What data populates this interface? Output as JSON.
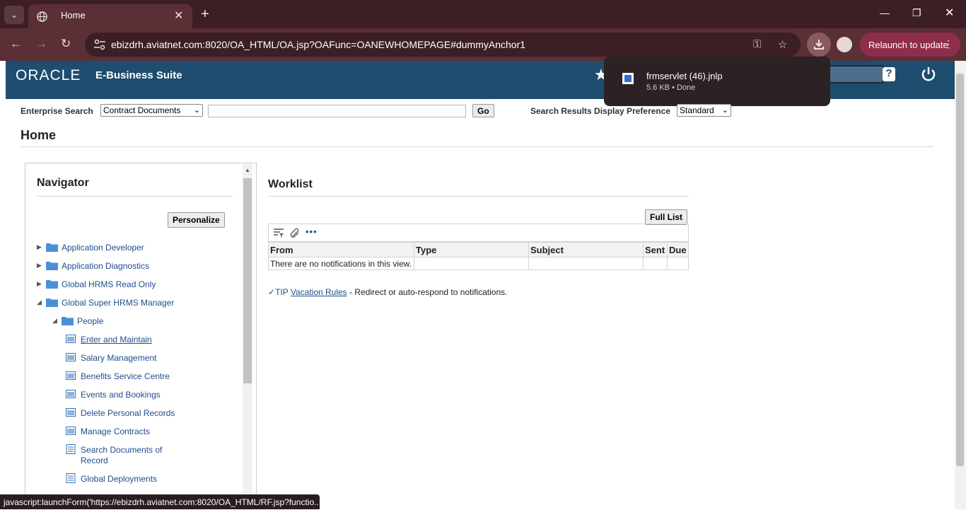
{
  "browser": {
    "tab_title": "Home",
    "url": "ebizdrh.aviatnet.com:8020/OA_HTML/OA.jsp?OAFunc=OANEWHOMEPAGE#dummyAnchor1",
    "relaunch_label": "Relaunch to update",
    "status_url": "javascript:launchForm('https://ebizdrh.aviatnet.com:8020/OA_HTML/RF.jsp?functio..."
  },
  "download": {
    "filename": "frmservlet (46).jnlp",
    "status": "5.6 KB • Done"
  },
  "header": {
    "logo_text": "ORACLE",
    "suite_name": "E-Business Suite",
    "help_label": "?"
  },
  "search": {
    "label": "Enterprise Search",
    "category": "Contract Documents",
    "go_label": "Go",
    "pref_label": "Search Results Display Preference",
    "pref_value": "Standard"
  },
  "page": {
    "title": "Home"
  },
  "navigator": {
    "title": "Navigator",
    "personalize_label": "Personalize",
    "items": [
      {
        "label": "Application Developer"
      },
      {
        "label": "Application Diagnostics"
      },
      {
        "label": "Global HRMS Read Only"
      },
      {
        "label": "Global Super HRMS Manager"
      },
      {
        "label": "People"
      },
      {
        "label": "Enter and Maintain"
      },
      {
        "label": "Salary Management"
      },
      {
        "label": "Benefits Service Centre"
      },
      {
        "label": "Events and Bookings"
      },
      {
        "label": "Delete Personal Records"
      },
      {
        "label": "Manage Contracts"
      },
      {
        "label": "Search Documents of"
      },
      {
        "label": "Record"
      },
      {
        "label": "Global Deployments"
      }
    ]
  },
  "worklist": {
    "title": "Worklist",
    "full_list_label": "Full List",
    "columns": [
      "From",
      "Type",
      "Subject",
      "Sent",
      "Due"
    ],
    "empty_message": "There are no notifications in this view.",
    "tip_prefix": "TIP",
    "tip_link": "Vacation Rules",
    "tip_text": " - Redirect or auto-respond to notifications."
  },
  "icons": {
    "more_icon": "•••"
  },
  "colors": {
    "ebs_header": "#1e4d6f",
    "link": "#1e4d8c",
    "chrome_frame": "#3c1f24",
    "relaunch": "#8e2e4a"
  }
}
